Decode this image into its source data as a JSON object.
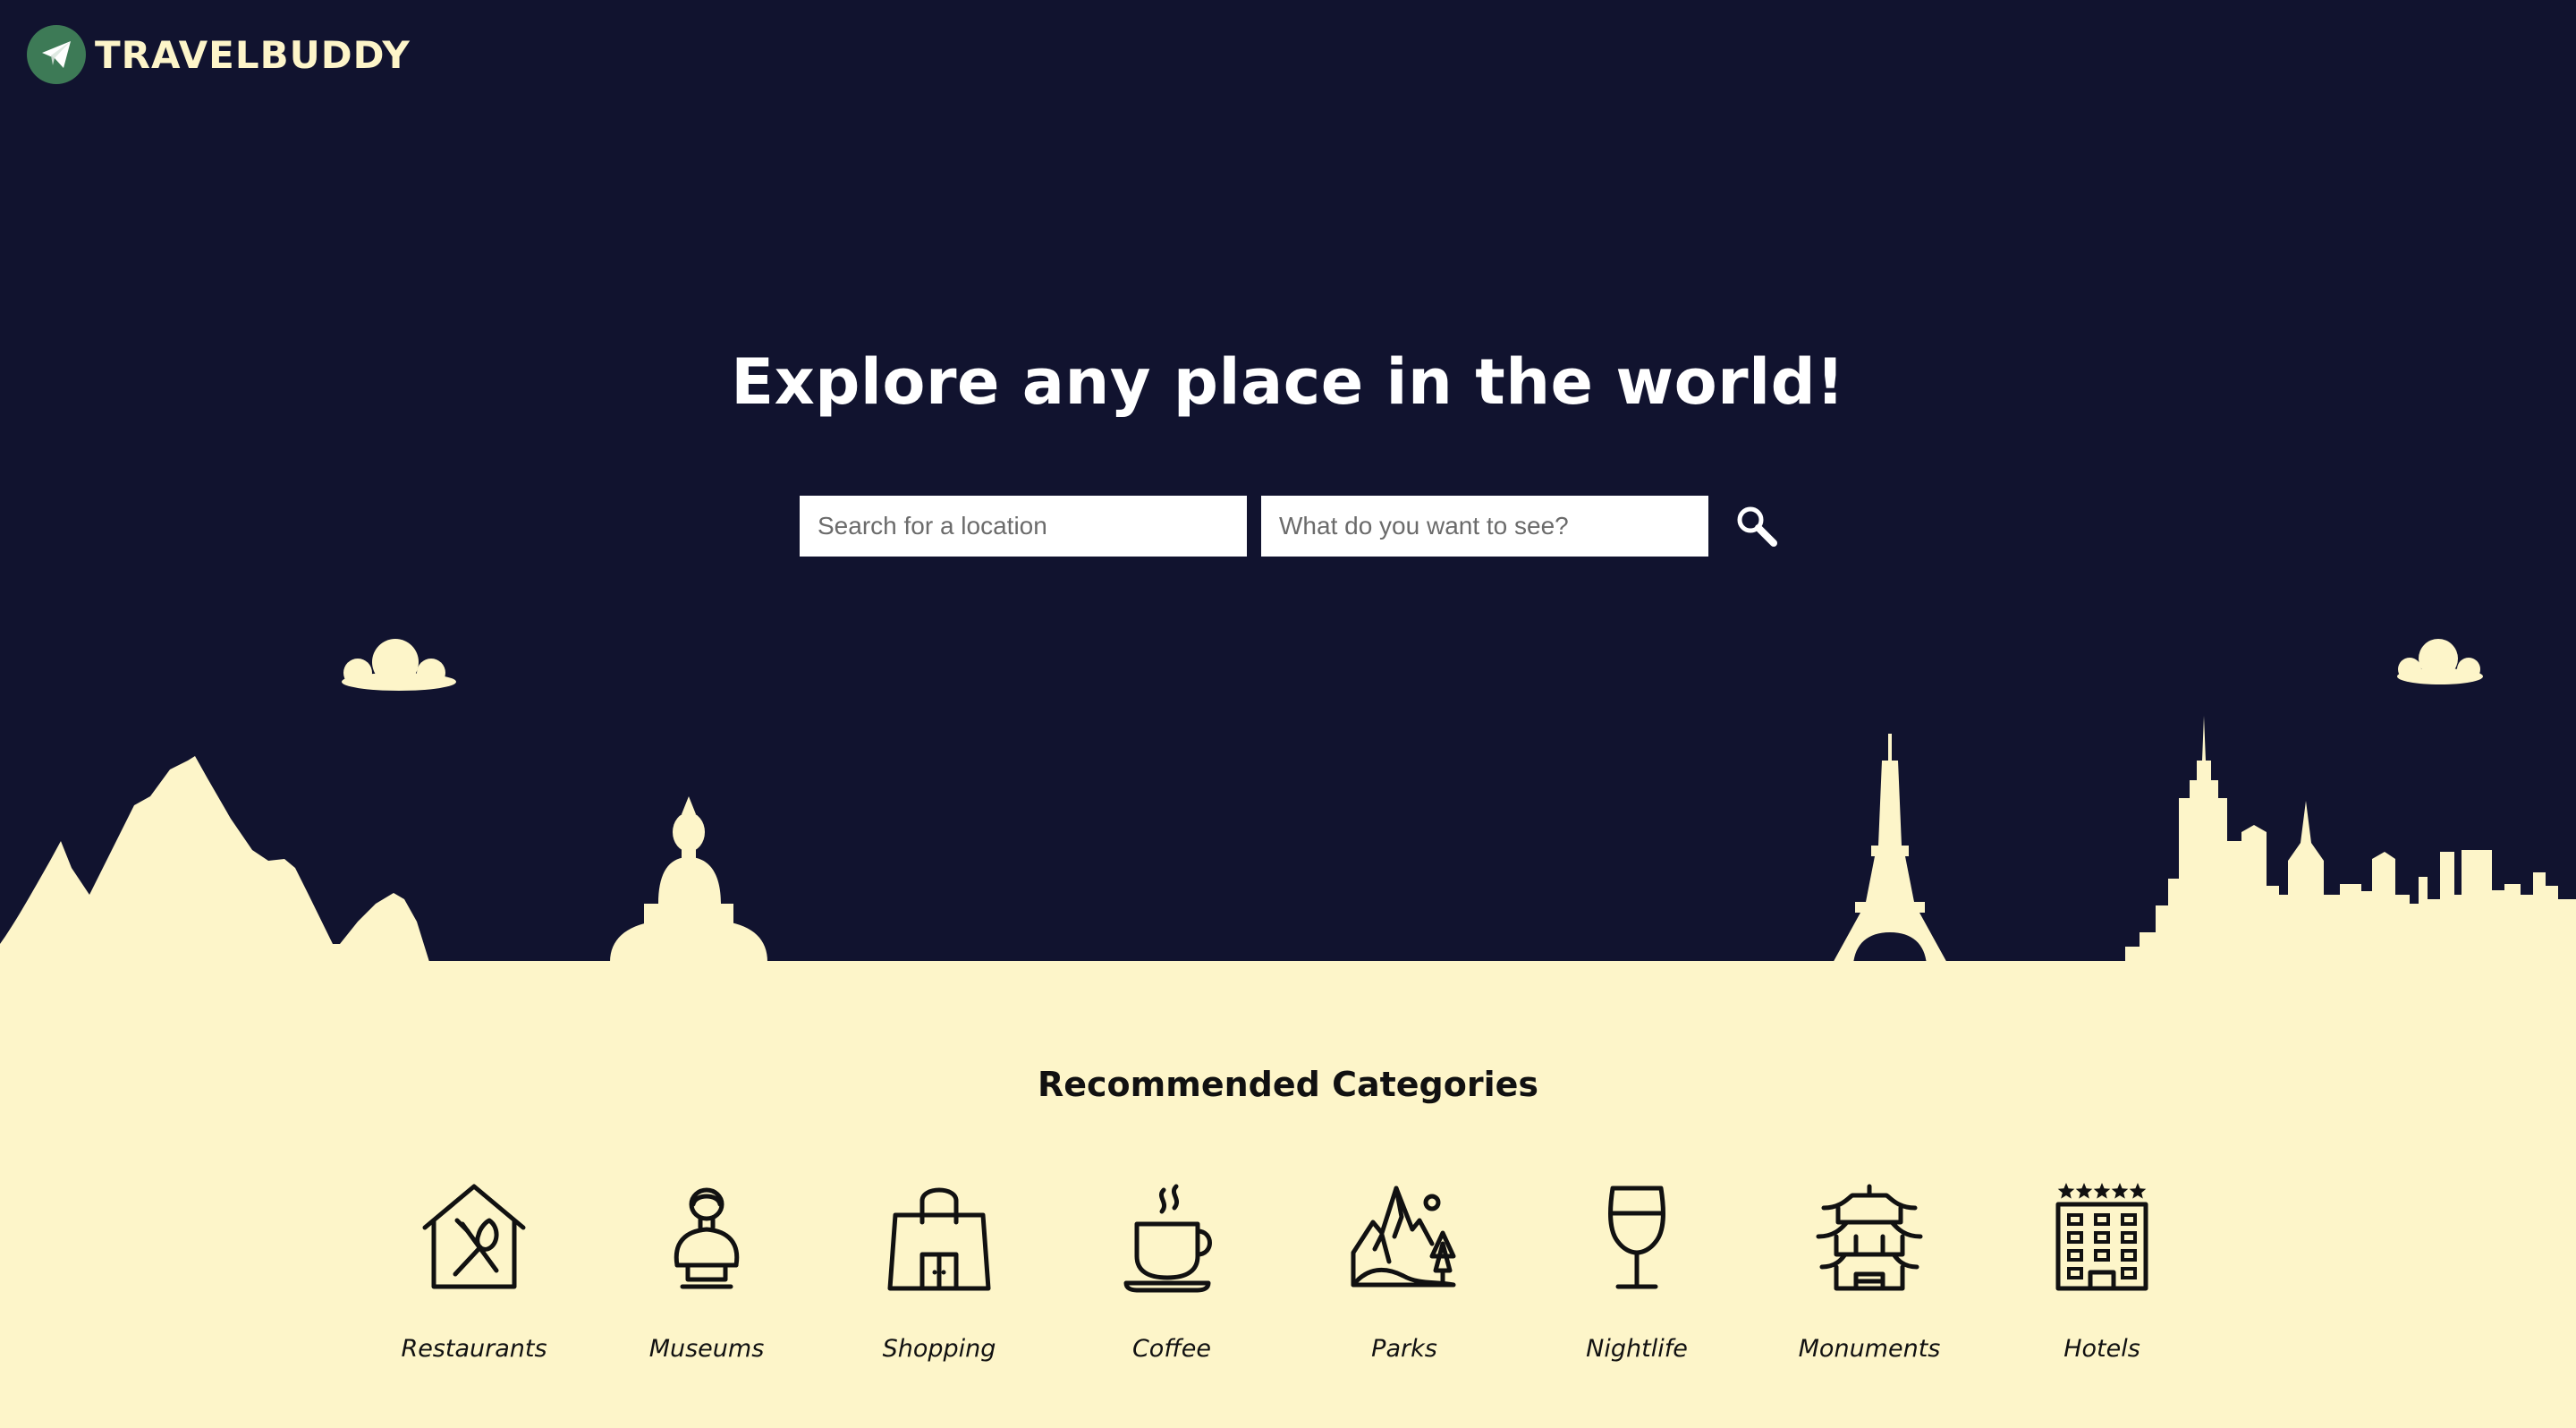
{
  "brand": {
    "name": "TRAVELBUDDY",
    "logo_icon": "paper-plane-icon"
  },
  "hero": {
    "headline": "Explore any place in the world!",
    "location_placeholder": "Search for a location",
    "interest_placeholder": "What do you want to see?",
    "search_icon": "magnifier-icon"
  },
  "categories": {
    "title": "Recommended Categories",
    "items": [
      {
        "label": "Restaurants",
        "icon": "restaurant-icon"
      },
      {
        "label": "Museums",
        "icon": "museum-bust-icon"
      },
      {
        "label": "Shopping",
        "icon": "shopping-bag-icon"
      },
      {
        "label": "Coffee",
        "icon": "coffee-cup-icon"
      },
      {
        "label": "Parks",
        "icon": "mountain-park-icon"
      },
      {
        "label": "Nightlife",
        "icon": "wine-glass-icon"
      },
      {
        "label": "Monuments",
        "icon": "pagoda-icon"
      },
      {
        "label": "Hotels",
        "icon": "hotel-building-icon"
      }
    ]
  },
  "colors": {
    "hero_background": "#11132f",
    "cream": "#fdf5c9",
    "logo_green": "#3d7a56",
    "text_dark": "#111111"
  }
}
